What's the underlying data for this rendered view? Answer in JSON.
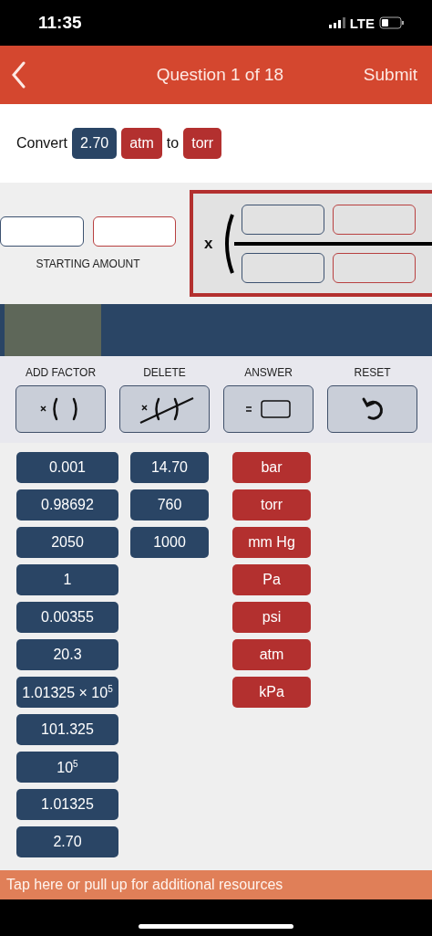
{
  "status_bar": {
    "time": "11:35",
    "network": "LTE"
  },
  "header": {
    "title": "Question 1 of 18",
    "action": "Submit"
  },
  "prompt": {
    "lead": "Convert",
    "value": "2.70",
    "from_unit": "atm",
    "joiner": "to",
    "to_unit": "torr"
  },
  "workspace": {
    "starting_label": "STARTING AMOUNT",
    "factor_operator": "x"
  },
  "tools": [
    {
      "kind": "add",
      "label": "ADD FACTOR"
    },
    {
      "kind": "delete",
      "label": "DELETE"
    },
    {
      "kind": "answer",
      "label": "ANSWER"
    },
    {
      "kind": "reset",
      "label": "RESET"
    }
  ],
  "tiles": {
    "numbers": [
      "0.001",
      "0.98692",
      "2050",
      "1",
      "0.00355",
      "20.3",
      "1.01325 × 10$^{5}$",
      "101.325",
      "10$^{5}$",
      "1.01325",
      "2.70"
    ],
    "more_numbers": [
      "14.70",
      "760",
      "1000"
    ],
    "units": [
      "bar",
      "torr",
      "mm Hg",
      "Pa",
      "psi",
      "atm",
      "kPa"
    ]
  },
  "footer": {
    "text": "Tap here or pull up for additional resources"
  }
}
